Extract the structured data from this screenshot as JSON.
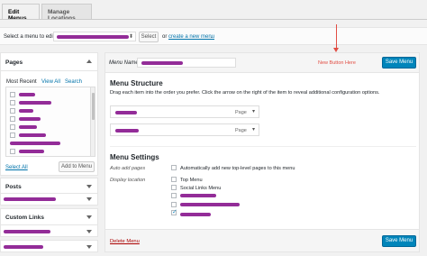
{
  "tabs": [
    {
      "label": "Edit Menus",
      "active": true
    },
    {
      "label": "Manage Locations",
      "active": false
    }
  ],
  "select_bar": {
    "prompt": "Select a menu to edit:",
    "select_button": "Select",
    "or_text": "or",
    "create_link": "create a new menu",
    "period": "."
  },
  "left": {
    "pages": {
      "title": "Pages",
      "tabs": [
        "Most Recent",
        "View All",
        "Search"
      ],
      "checked": [
        false,
        false,
        false,
        false,
        false,
        false,
        false,
        false
      ],
      "select_all": "Select All",
      "add_button": "Add to Menu"
    },
    "posts_title": "Posts",
    "custom_links_title": "Custom Links"
  },
  "right": {
    "menu_name_label": "Menu Name",
    "annotation": "New Button Here",
    "save_button": "Save Menu",
    "structure_title": "Menu Structure",
    "structure_desc": "Drag each item into the order you prefer. Click the arrow on the right of the item to reveal additional configuration options.",
    "items": [
      {
        "type": "Page"
      },
      {
        "type": "Page"
      }
    ],
    "settings_title": "Menu Settings",
    "auto_add_label": "Auto add pages",
    "auto_add_text": "Automatically add new top-level pages to this menu",
    "display_location_label": "Display location",
    "locations": [
      {
        "label": "Top Menu",
        "checked": false
      },
      {
        "label": "Social Links Menu",
        "checked": false
      },
      {
        "label": "",
        "checked": false
      },
      {
        "label": "",
        "checked": false
      },
      {
        "label": "",
        "checked": true
      }
    ],
    "delete_link": "Delete Menu",
    "save_button_bottom": "Save Menu"
  },
  "colors": {
    "primary": "#0085ba",
    "link": "#0073aa",
    "annotation": "#e14d43",
    "delete": "#a00",
    "redaction": "#8a1a8f"
  }
}
